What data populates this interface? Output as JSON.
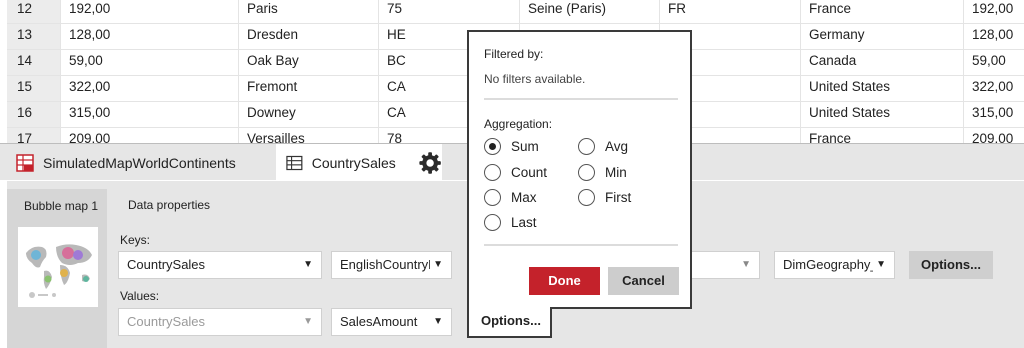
{
  "grid": {
    "rows": [
      {
        "num": "12",
        "c1": "192,00",
        "c2": "Paris",
        "c3": "75",
        "c4": "Seine (Paris)",
        "c5": "FR",
        "c6": "France",
        "c7": "192,00"
      },
      {
        "num": "13",
        "c1": "128,00",
        "c2": "Dresden",
        "c3": "HE",
        "c4": "",
        "c5": "",
        "c6": "Germany",
        "c7": "128,00"
      },
      {
        "num": "14",
        "c1": "59,00",
        "c2": "Oak Bay",
        "c3": "BC",
        "c4": "",
        "c5": "",
        "c6": "Canada",
        "c7": "59,00"
      },
      {
        "num": "15",
        "c1": "322,00",
        "c2": "Fremont",
        "c3": "CA",
        "c4": "",
        "c5": "",
        "c6": "United States",
        "c7": "322,00"
      },
      {
        "num": "16",
        "c1": "315,00",
        "c2": "Downey",
        "c3": "CA",
        "c4": "",
        "c5": "",
        "c6": "United States",
        "c7": "315,00"
      },
      {
        "num": "17",
        "c1": "209,00",
        "c2": "Versailles",
        "c3": "78",
        "c4": "",
        "c5": "",
        "c6": "France",
        "c7": "209,00"
      }
    ]
  },
  "tabs": {
    "inactive_label": "SimulatedMapWorldContinents",
    "active_label": "CountrySales"
  },
  "panel": {
    "bubble_tab_label": "Bubble map 1",
    "data_properties_label": "Data properties",
    "keys_label": "Keys:",
    "values_label": "Values:",
    "keys_source": "CountrySales",
    "keys_field": "EnglishCountryR",
    "values_source": "CountrySales",
    "values_field": "SalesAmount",
    "geo_field": "DimGeography_",
    "options_label": "Options..."
  },
  "popup": {
    "filtered_by_label": "Filtered by:",
    "no_filters_text": "No filters available.",
    "aggregation_label": "Aggregation:",
    "options": [
      "Sum",
      "Avg",
      "Count",
      "Min",
      "Max",
      "First",
      "Last"
    ],
    "selected": "Sum",
    "done_label": "Done",
    "cancel_label": "Cancel",
    "tab_label": "Options..."
  },
  "colors": {
    "accent": "#c4222b",
    "rownum_bg": "#ececec",
    "panel_bg": "#e6e6e6"
  }
}
